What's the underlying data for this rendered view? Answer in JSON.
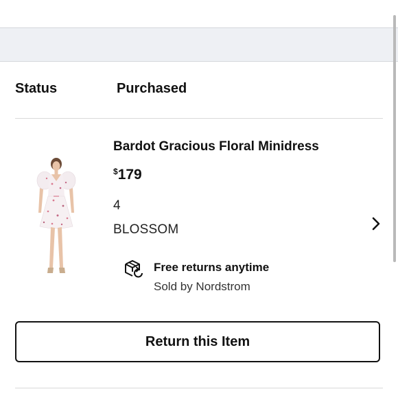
{
  "order": {
    "status_label": "Status",
    "status_value": "Purchased"
  },
  "item": {
    "name": "Bardot Gracious Floral Minidress",
    "price_currency": "$",
    "price_amount": "179",
    "size": "4",
    "color": "BLOSSOM",
    "image_icon": "floral-minidress-photo",
    "chevron_icon": "chevron-right-icon"
  },
  "returns": {
    "icon": "box-return-icon",
    "title": "Free returns anytime",
    "sold_by": "Sold by Nordstrom"
  },
  "actions": {
    "return_label": "Return this Item"
  },
  "colors": {
    "band_background": "#eef0f4",
    "divider": "#d9d9d9",
    "text_primary": "#111111"
  }
}
